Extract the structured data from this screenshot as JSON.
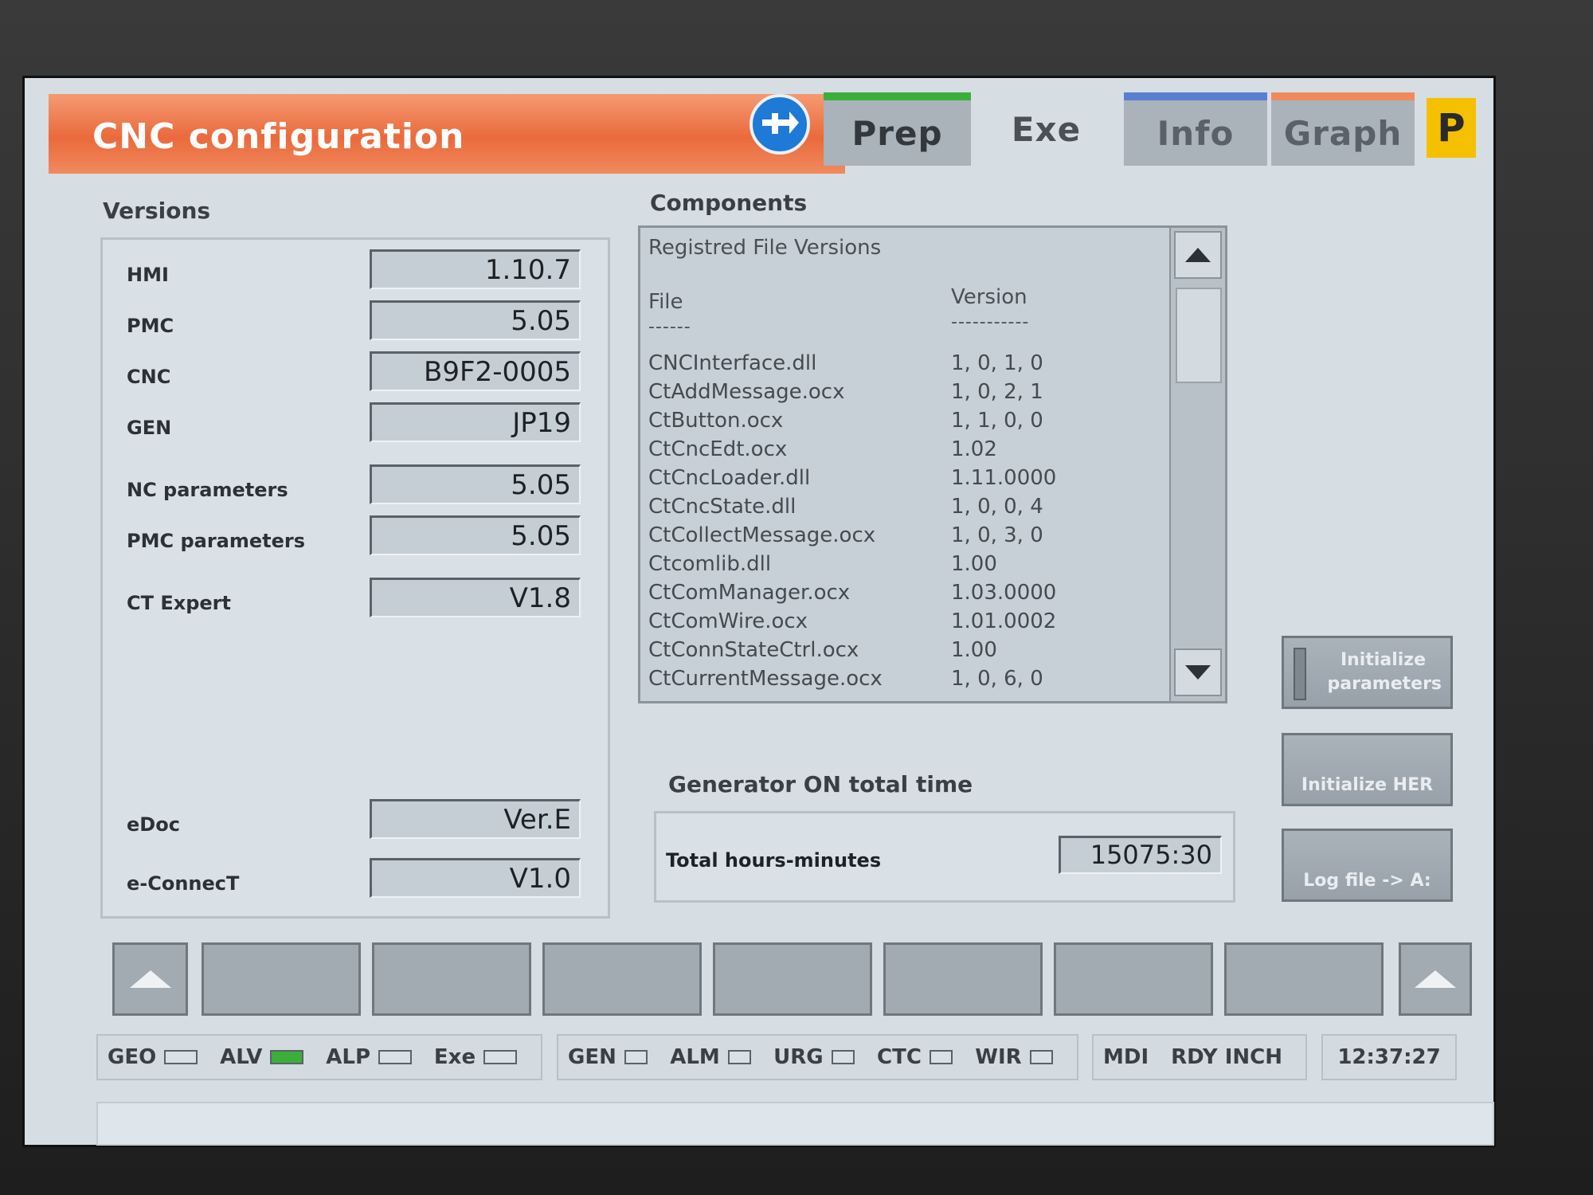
{
  "header": {
    "title": "CNC configuration",
    "tabs": {
      "prep": "Prep",
      "exe": "Exe",
      "info": "Info",
      "graph": "Graph",
      "p": "P"
    },
    "nav_icon": "arrow-exchange-icon"
  },
  "versions": {
    "heading": "Versions",
    "rows": [
      {
        "label": "HMI",
        "value": "1.10.7"
      },
      {
        "label": "PMC",
        "value": "5.05"
      },
      {
        "label": "CNC",
        "value": "B9F2-0005"
      },
      {
        "label": "GEN",
        "value": "JP19"
      },
      {
        "label": "NC parameters",
        "value": "5.05"
      },
      {
        "label": "PMC parameters",
        "value": "5.05"
      },
      {
        "label": "CT Expert",
        "value": "V1.8"
      },
      {
        "label": "eDoc",
        "value": "Ver.E"
      },
      {
        "label": "e-ConnecT",
        "value": "V1.0"
      }
    ]
  },
  "components": {
    "heading": "Components",
    "list_heading": "Registred File Versions",
    "col_file": "File",
    "col_version": "Version",
    "col_file_dash": "------",
    "col_version_dash": "-----------",
    "files": [
      {
        "name": "CNCInterface.dll",
        "version": "1, 0, 1, 0"
      },
      {
        "name": "CtAddMessage.ocx",
        "version": "1, 0, 2, 1"
      },
      {
        "name": "CtButton.ocx",
        "version": "1, 1, 0, 0"
      },
      {
        "name": "CtCncEdt.ocx",
        "version": "1.02"
      },
      {
        "name": "CtCncLoader.dll",
        "version": "1.11.0000"
      },
      {
        "name": "CtCncState.dll",
        "version": "1, 0, 0, 4"
      },
      {
        "name": "CtCollectMessage.ocx",
        "version": "1, 0, 3, 0"
      },
      {
        "name": "Ctcomlib.dll",
        "version": "1.00"
      },
      {
        "name": "CtComManager.ocx",
        "version": "1.03.0000"
      },
      {
        "name": "CtComWire.ocx",
        "version": "1.01.0002"
      },
      {
        "name": "CtConnStateCtrl.ocx",
        "version": "1.00"
      },
      {
        "name": "CtCurrentMessage.ocx",
        "version": "1, 0, 6, 0"
      }
    ]
  },
  "generator": {
    "heading": "Generator ON total time",
    "label": "Total hours-minutes",
    "value": "15075:30"
  },
  "side_buttons": {
    "init_params": "Initialize parameters",
    "init_her": "Initialize HER",
    "log_file": "Log file -> A:"
  },
  "status": {
    "group1": [
      {
        "label": "GEO",
        "on": false
      },
      {
        "label": "ALV",
        "on": true
      },
      {
        "label": "ALP",
        "on": false
      },
      {
        "label": "Exe",
        "on": false
      }
    ],
    "group2": [
      {
        "label": "GEN",
        "on": false
      },
      {
        "label": "ALM",
        "on": false
      },
      {
        "label": "URG",
        "on": false
      },
      {
        "label": "CTC",
        "on": false
      },
      {
        "label": "WIR",
        "on": false
      }
    ],
    "mode": "MDI",
    "ready": "RDY INCH",
    "clock": "12:37:27"
  },
  "colors": {
    "title_bar": "#ea6a3c",
    "prep_accent": "#3cae3c",
    "info_accent": "#5a7fd0",
    "graph_accent": "#f08a5e",
    "p_badge": "#f4c000",
    "nav_icon": "#1e7ad6",
    "lamp_on": "#3cae3c"
  }
}
